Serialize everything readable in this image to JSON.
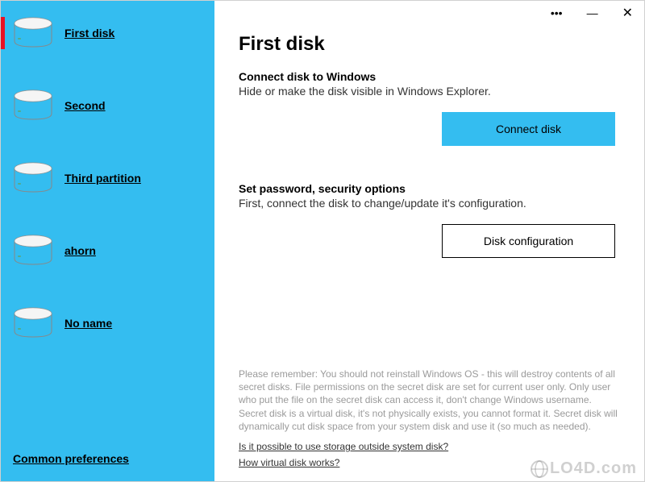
{
  "sidebar": {
    "items": [
      {
        "label": "First disk",
        "active": true
      },
      {
        "label": "Second",
        "active": false
      },
      {
        "label": "Third partition",
        "active": false
      },
      {
        "label": "ahorn",
        "active": false
      },
      {
        "label": "No name",
        "active": false
      }
    ],
    "bottom_link": "Common preferences"
  },
  "titlebar": {
    "more": "•••",
    "minimize": "—",
    "close": "✕"
  },
  "main": {
    "title": "First disk",
    "section1": {
      "title": "Connect disk to Windows",
      "desc": "Hide or make the disk visible in Windows Explorer.",
      "button": "Connect disk"
    },
    "section2": {
      "title": "Set password, security options",
      "desc": "First, connect the disk to change/update it's configuration.",
      "button": "Disk configuration"
    },
    "note": "Please remember: You should not reinstall Windows OS - this will destroy contents of all secret disks. File permissions on the secret disk are set for current user only. Only user who put the file on the secret disk can access it, don't change Windows username. Secret disk is a virtual disk, it's not physically exists, you cannot format it. Secret disk will dynamically cut disk space from your system disk and use it (so much as needed).",
    "faq1": "Is it possible to use storage outside system disk?",
    "faq2": "How virtual disk works?"
  },
  "watermark": "LO4D.com"
}
